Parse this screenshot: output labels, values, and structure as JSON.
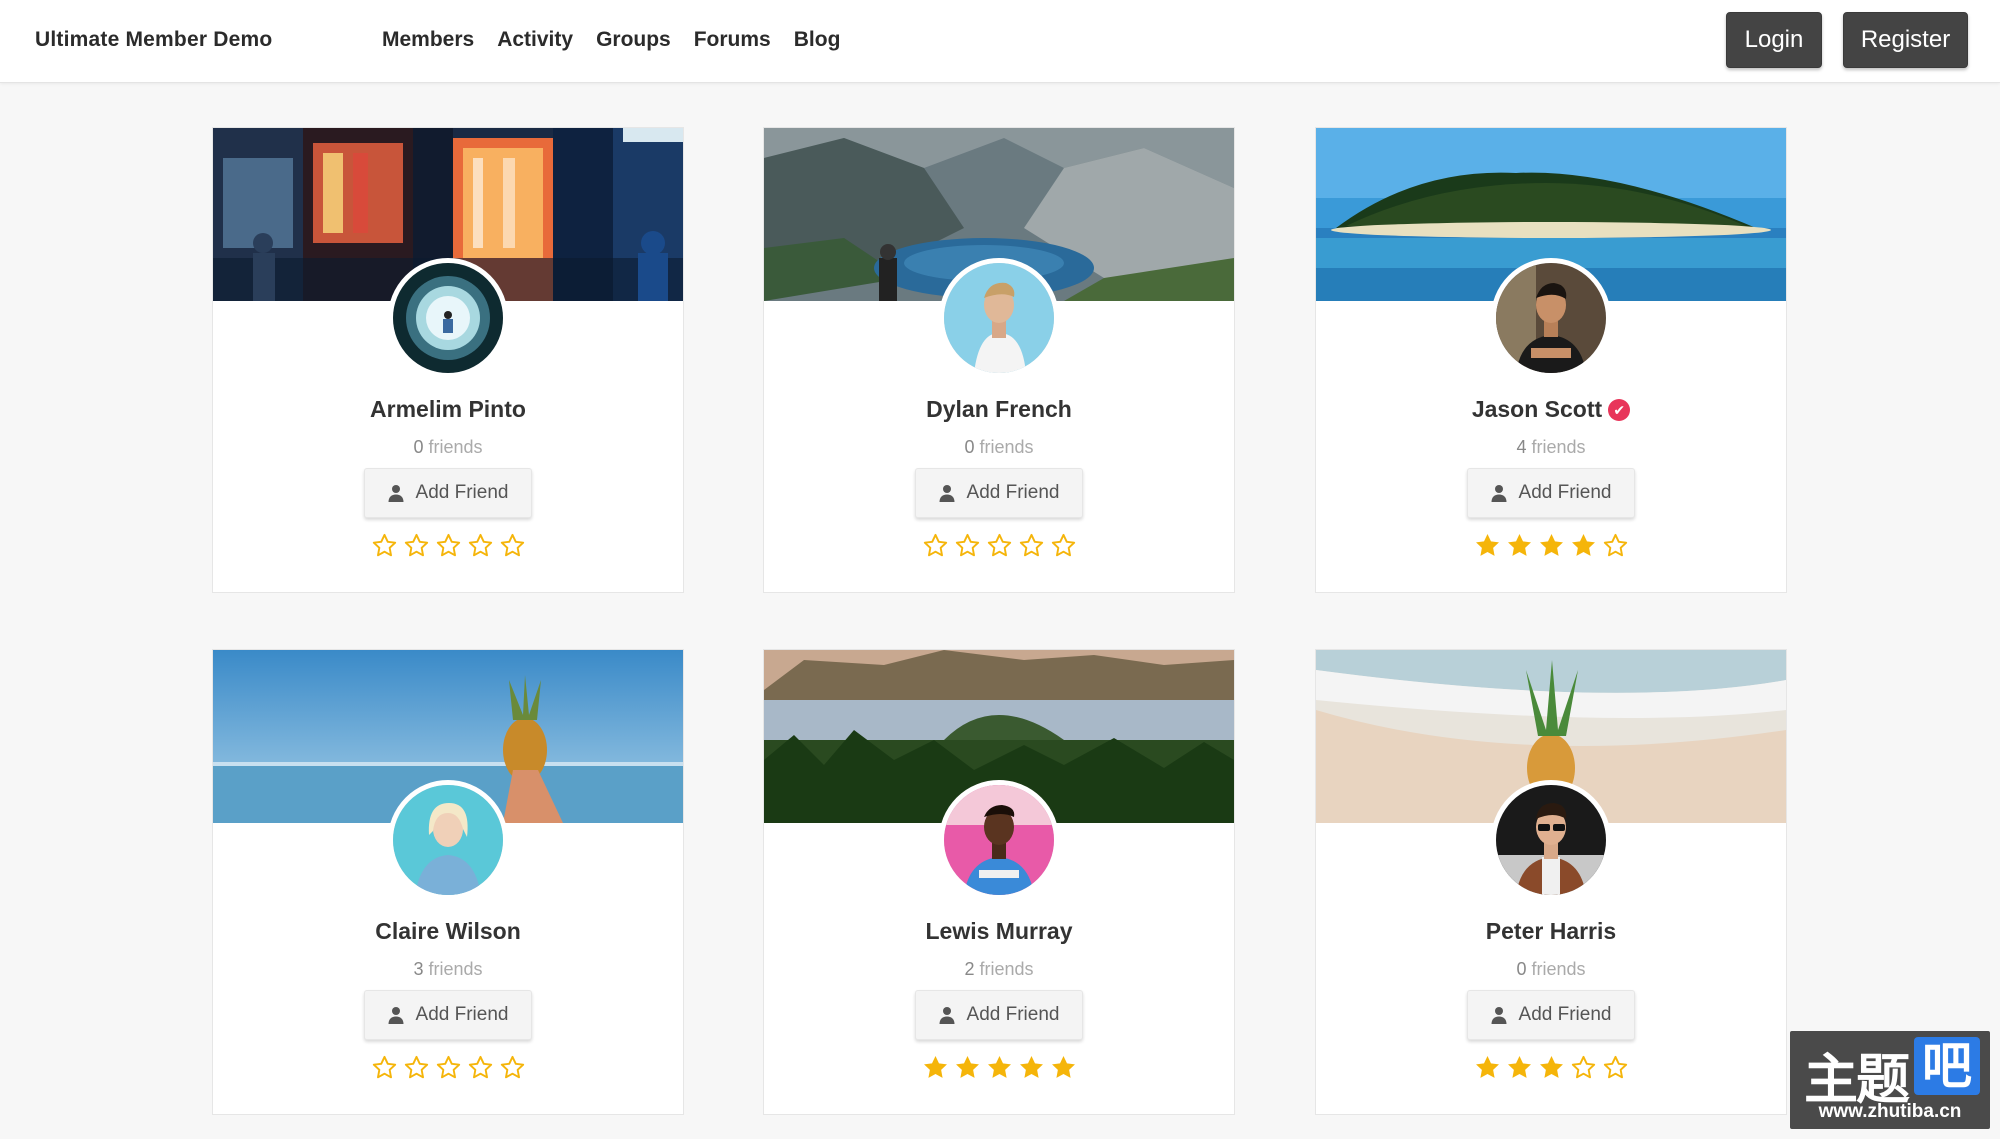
{
  "header": {
    "site_title": "Ultimate Member Demo",
    "nav": [
      {
        "label": "Members"
      },
      {
        "label": "Activity"
      },
      {
        "label": "Groups"
      },
      {
        "label": "Forums"
      },
      {
        "label": "Blog"
      }
    ],
    "login_label": "Login",
    "register_label": "Register"
  },
  "colors": {
    "star": "#f5b50a",
    "verified": "#e8355a",
    "dark_button": "#444444"
  },
  "members": [
    {
      "name": "Armelim Pinto",
      "friends_count": "0",
      "friends_label": "friends",
      "add_label": "Add Friend",
      "rating": 0,
      "verified": false
    },
    {
      "name": "Dylan French",
      "friends_count": "0",
      "friends_label": "friends",
      "add_label": "Add Friend",
      "rating": 0,
      "verified": false
    },
    {
      "name": "Jason Scott",
      "friends_count": "4",
      "friends_label": "friends",
      "add_label": "Add Friend",
      "rating": 4,
      "verified": true
    },
    {
      "name": "Claire Wilson",
      "friends_count": "3",
      "friends_label": "friends",
      "add_label": "Add Friend",
      "rating": 0,
      "verified": false
    },
    {
      "name": "Lewis Murray",
      "friends_count": "2",
      "friends_label": "friends",
      "add_label": "Add Friend",
      "rating": 5,
      "verified": false
    },
    {
      "name": "Peter Harris",
      "friends_count": "0",
      "friends_label": "friends",
      "add_label": "Add Friend",
      "rating": 3,
      "verified": false
    }
  ],
  "watermark": {
    "text": "主题",
    "badge": "吧",
    "url": "www.zhutiba.cn"
  }
}
